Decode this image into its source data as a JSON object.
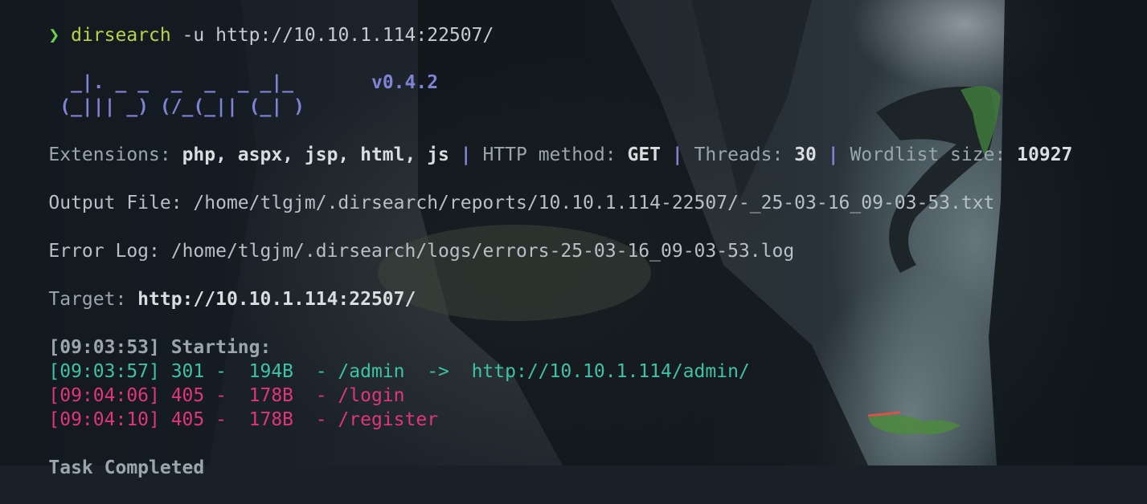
{
  "prompt": {
    "symbol": "❯",
    "command": "dirsearch",
    "args": " -u http://10.10.1.114:22507/"
  },
  "banner": {
    "line1": "  _|. _ _  _  _  _ _|_",
    "line2": " (_||| _) (/_(_|| (_| )",
    "version": "v0.4.2"
  },
  "config": {
    "extensions_key": "Extensions: ",
    "extensions_val": "php, aspx, jsp, html, js",
    "sep": " | ",
    "method_key": "HTTP method: ",
    "method_val": "GET",
    "threads_key": "Threads: ",
    "threads_val": "30",
    "wordlist_key": "Wordlist size: ",
    "wordlist_val": "10927"
  },
  "output_file": {
    "key": "Output File: ",
    "value": "/home/tlgjm/.dirsearch/reports/10.10.1.114-22507/-_25-03-16_09-03-53.txt"
  },
  "error_log": {
    "key": "Error Log: ",
    "value": "/home/tlgjm/.dirsearch/logs/errors-25-03-16_09-03-53.log"
  },
  "target": {
    "key": "Target: ",
    "value": "http://10.10.1.114:22507/"
  },
  "starting": "[09:03:53] Starting:",
  "results": [
    {
      "text": "[09:03:57] 301 -  194B  - /admin  ->  http://10.10.1.114/admin/",
      "color": "#3fc1a8"
    },
    {
      "text": "[09:04:06] 405 -  178B  - /login",
      "color": "#e0357a"
    },
    {
      "text": "[09:04:10] 405 -  178B  - /register",
      "color": "#e0357a"
    }
  ],
  "task_completed": "Task Completed"
}
